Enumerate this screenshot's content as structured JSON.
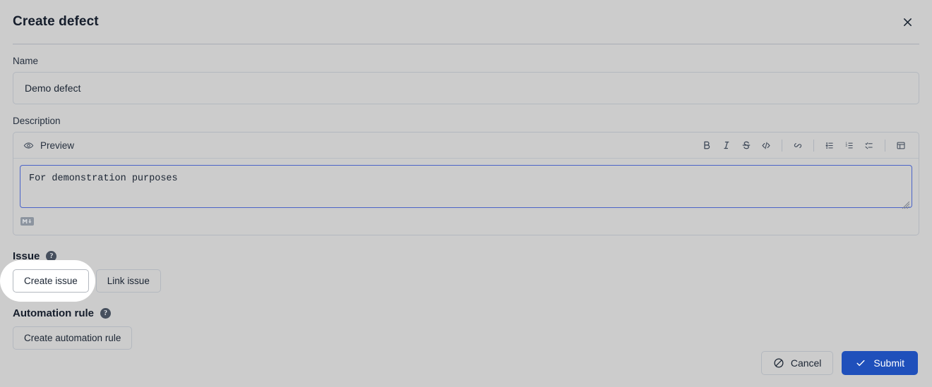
{
  "dialog": {
    "title": "Create defect",
    "close_icon": "close-icon"
  },
  "name_field": {
    "label": "Name",
    "value": "Demo defect",
    "placeholder": ""
  },
  "description_field": {
    "label": "Description",
    "preview_label": "Preview",
    "preview_icon": "eye-icon",
    "value": "For demonstration purposes",
    "markdown_badge": "M",
    "toolbar": [
      {
        "name": "bold-icon",
        "label": "B"
      },
      {
        "name": "italic-icon",
        "label": "I"
      },
      {
        "name": "strikethrough-icon",
        "label": "S"
      },
      {
        "name": "code-icon",
        "label": "</>"
      },
      {
        "name": "link-icon",
        "label": "Link"
      },
      {
        "name": "bullet-list-icon",
        "label": "Bulleted list"
      },
      {
        "name": "numbered-list-icon",
        "label": "Numbered list"
      },
      {
        "name": "checklist-icon",
        "label": "Checklist"
      },
      {
        "name": "table-icon",
        "label": "Table"
      }
    ]
  },
  "issue_section": {
    "title": "Issue",
    "help_icon": "help-icon",
    "help_glyph": "?",
    "create_button": "Create issue",
    "link_button": "Link issue"
  },
  "automation_section": {
    "title": "Automation rule",
    "help_icon": "help-icon",
    "help_glyph": "?",
    "create_button": "Create automation rule"
  },
  "footer": {
    "cancel_label": "Cancel",
    "cancel_icon": "no-entry-icon",
    "submit_label": "Submit",
    "submit_icon": "check-icon",
    "submit_color": "#1f50bb"
  }
}
